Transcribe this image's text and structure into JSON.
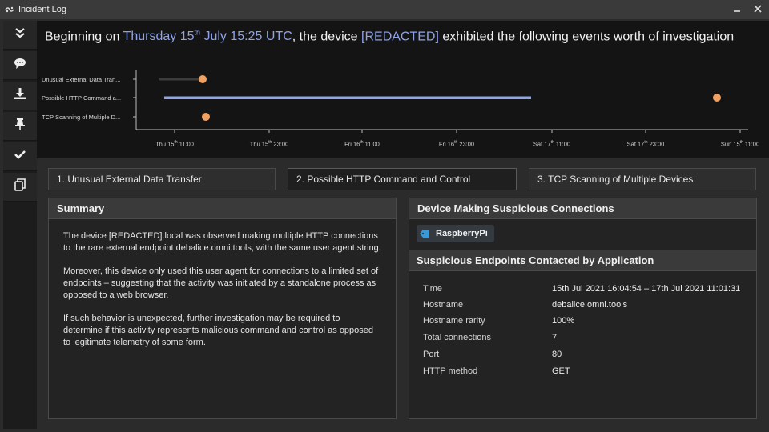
{
  "window": {
    "title": "Incident Log"
  },
  "sidebar": {
    "buttons": [
      {
        "icon": "double-chevron-down-icon"
      },
      {
        "icon": "chat-bubble-icon"
      },
      {
        "icon": "download-icon"
      },
      {
        "icon": "pin-icon"
      },
      {
        "icon": "checkmark-icon"
      },
      {
        "icon": "copy-icon"
      }
    ]
  },
  "header": {
    "prefix": "Beginning on ",
    "date_day": "Thursday 15",
    "date_suffix": "th",
    "date_rest": " July 15:25 UTC",
    "middle": ", the device ",
    "device": "[REDACTED]",
    "suffix": " exhibited the following events worth of investigation"
  },
  "timeline": {
    "rows": [
      "Unusual External Data Tran...",
      "Possible HTTP Command a...",
      "TCP Scanning of Multiple D..."
    ],
    "ticks": [
      {
        "a": "Thu 15",
        "sup": "th",
        "b": " 11:00"
      },
      {
        "a": "Thu 15",
        "sup": "th",
        "b": " 23:00"
      },
      {
        "a": "Fri 16",
        "sup": "th",
        "b": " 11:00"
      },
      {
        "a": "Fri 16",
        "sup": "th",
        "b": " 23:00"
      },
      {
        "a": "Sat  17",
        "sup": "th",
        "b": " 11:00"
      },
      {
        "a": "Sat 17",
        "sup": "th",
        "b": " 23:00"
      },
      {
        "a": "Sun 15",
        "sup": "th",
        "b": " 11:00"
      }
    ],
    "colors": {
      "bar_row1": "#3c3c3c",
      "bar_row2": "#8fa3e6",
      "marker": "#f0a060"
    }
  },
  "tabs": [
    "1. Unusual External Data Transfer",
    "2. Possible HTTP Command and Control",
    "3. TCP Scanning of Multiple Devices"
  ],
  "summary": {
    "title": "Summary",
    "paragraphs": [
      "The device [REDACTED].local was observed making multiple HTTP connections to the rare external endpoint debalice.omni.tools, with the same user agent string.",
      "Moreover, this device only used this user agent for connections to a limited set of endpoints – suggesting that the activity was initiated by a standalone process as opposed to a web browser.",
      "If such behavior is unexpected, further investigation may be required to determine if this activity represents malicious command and control as opposed to legitimate telemetry of some form."
    ]
  },
  "device_panel": {
    "title": "Device Making Suspicious Connections",
    "device_name": "RaspberryPi",
    "tag_color": "#3a9ad9"
  },
  "endpoints": {
    "title": "Suspicious Endpoints Contacted by Application",
    "rows": [
      {
        "key": "Time",
        "value": "15th Jul 2021 16:04:54 – 17th Jul 2021 11:01:31"
      },
      {
        "key": "Hostname",
        "value": "debalice.omni.tools"
      },
      {
        "key": "Hostname rarity",
        "value": "100%"
      },
      {
        "key": "Total connections",
        "value": "7"
      },
      {
        "key": "Port",
        "value": "80"
      },
      {
        "key": "HTTP method",
        "value": "GET"
      }
    ]
  }
}
